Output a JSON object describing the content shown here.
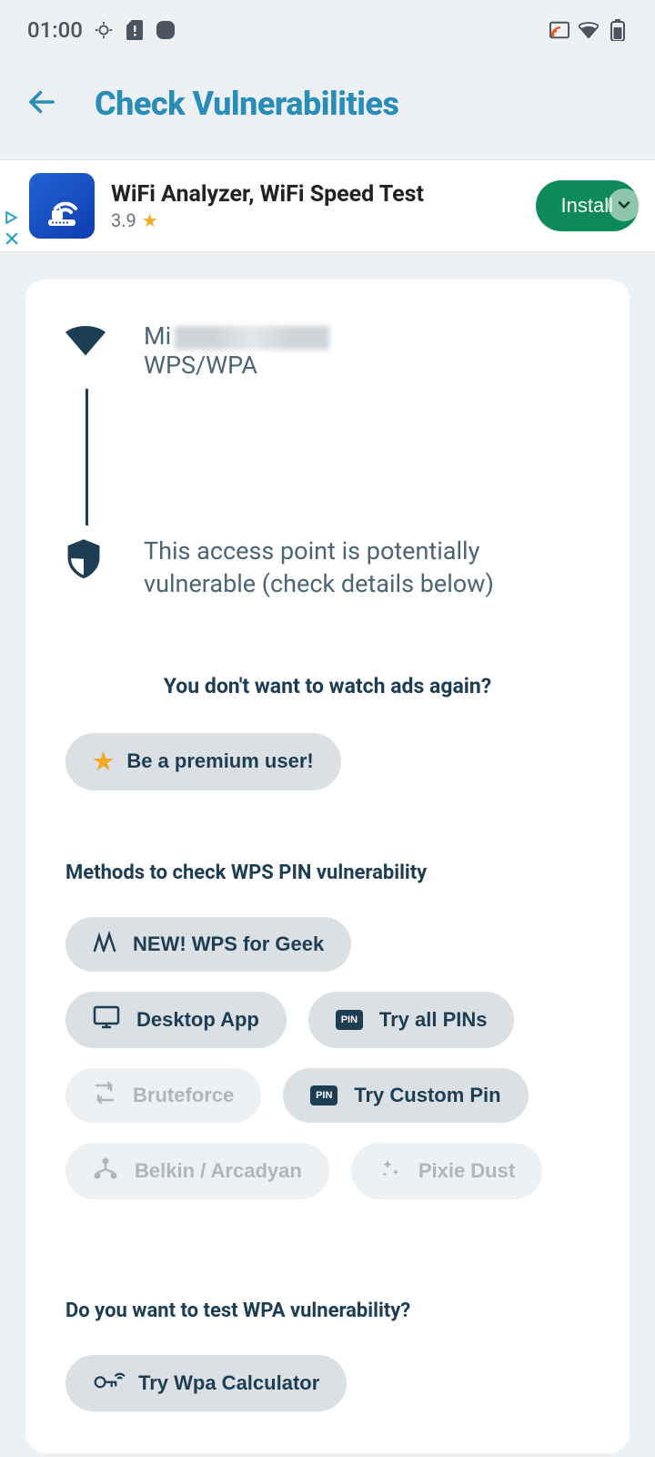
{
  "status": {
    "time": "01:00"
  },
  "header": {
    "title": "Check Vulnerabilities"
  },
  "ad": {
    "title": "WiFi Analyzer, WiFi Speed Test",
    "rating": "3.9",
    "cta": "Install"
  },
  "network": {
    "name_prefix": "Mi",
    "security": "WPS/WPA",
    "vuln_text": "This access point is potentially vulnerable (check details below)"
  },
  "ads_prompt": "You don't want to watch ads again?",
  "premium_button": "Be a premium user!",
  "wps_section_title": "Methods to check WPS PIN vulnerability",
  "chips": {
    "wps_geek": "NEW! WPS for Geek",
    "desktop": "Desktop App",
    "try_all": "Try all PINs",
    "bruteforce": "Bruteforce",
    "custom_pin": "Try Custom Pin",
    "belkin": "Belkin / Arcadyan",
    "pixie": "Pixie Dust"
  },
  "wpa_section_title": "Do you want to test WPA vulnerability?",
  "wpa_button": "Try Wpa Calculator"
}
